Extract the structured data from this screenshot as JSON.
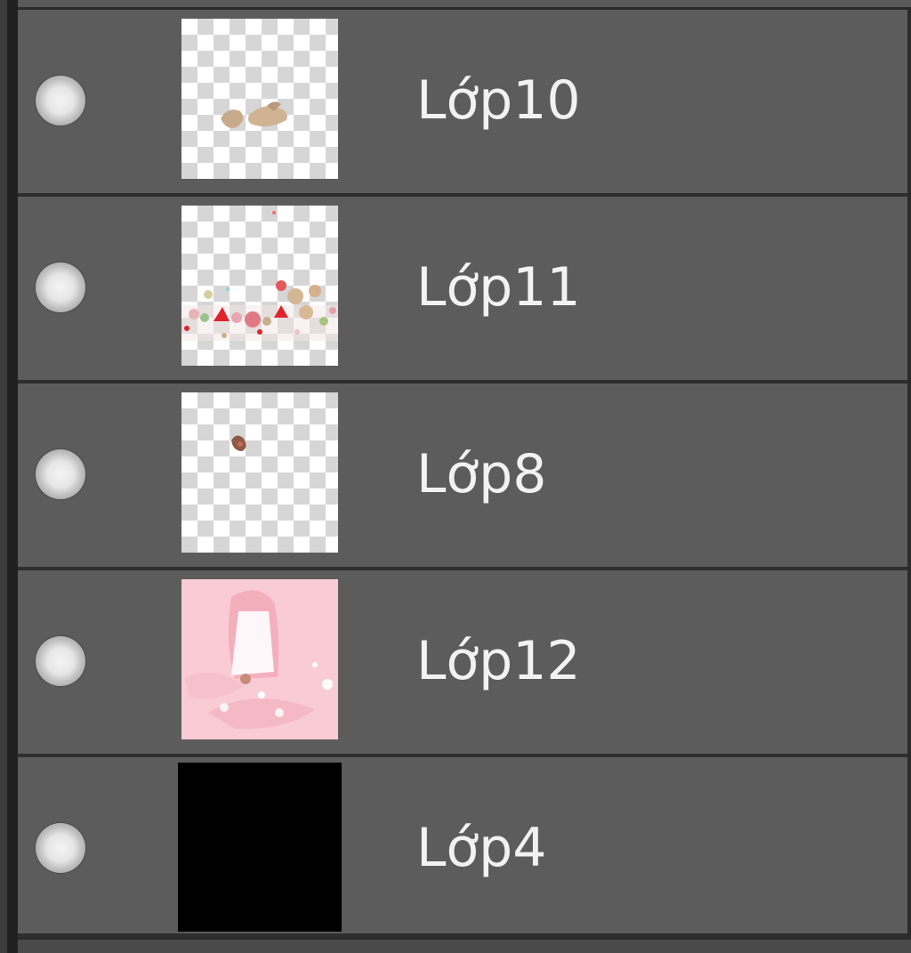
{
  "layers_panel": {
    "layers": [
      {
        "name": "Lớp10",
        "thumbnail": "transparent-with-beige-blobs"
      },
      {
        "name": "Lớp11",
        "thumbnail": "transparent-with-colorful-flowers"
      },
      {
        "name": "Lớp8",
        "thumbnail": "transparent-with-small-brown-mark"
      },
      {
        "name": "Lớp12",
        "thumbnail": "pink-character-artwork"
      },
      {
        "name": "Lớp4",
        "thumbnail": "solid-black"
      }
    ]
  },
  "colors": {
    "row_background": "#5c5c5c",
    "row_separator": "#2e2e2e",
    "text": "#f2f2f2",
    "visibility_dot": "#e6e6e6",
    "pink_thumb": "#f8c7d0"
  }
}
